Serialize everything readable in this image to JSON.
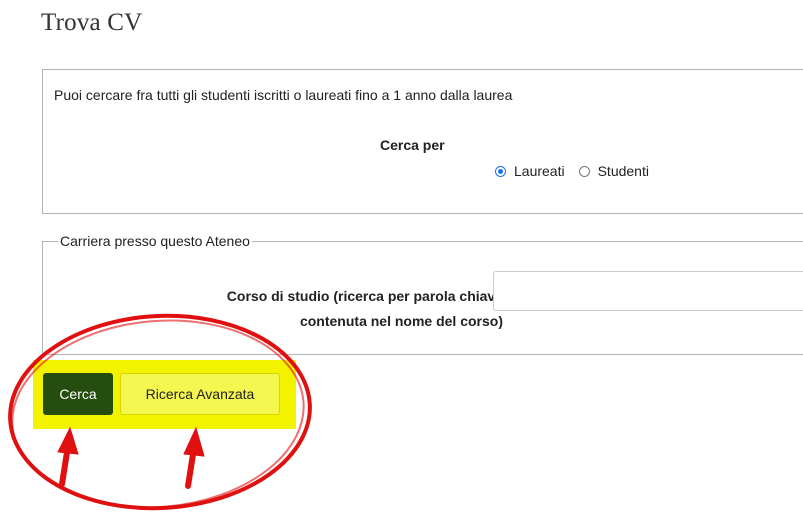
{
  "page": {
    "title": "Trova CV"
  },
  "search": {
    "intro": "Puoi cercare fra tutti gli studenti iscritti o laureati fino a 1 anno dalla laurea",
    "cerca_per_label": "Cerca per",
    "options": [
      {
        "label": "Laureati",
        "checked": true
      },
      {
        "label": "Studenti",
        "checked": false
      }
    ]
  },
  "career": {
    "legend": "Carriera presso questo Ateneo",
    "course_label_line1": "Corso di studio (ricerca per parola chiave",
    "course_label_line2": "contenuta nel nome del corso)",
    "course_value": ""
  },
  "actions": {
    "cerca_label": "Cerca",
    "advanced_label": "Ricerca Avanzata"
  },
  "colors": {
    "primary_button": "#254d0f",
    "highlight": "#f3f300",
    "annotation": "#e01010",
    "radio_accent": "#1a73e8"
  }
}
